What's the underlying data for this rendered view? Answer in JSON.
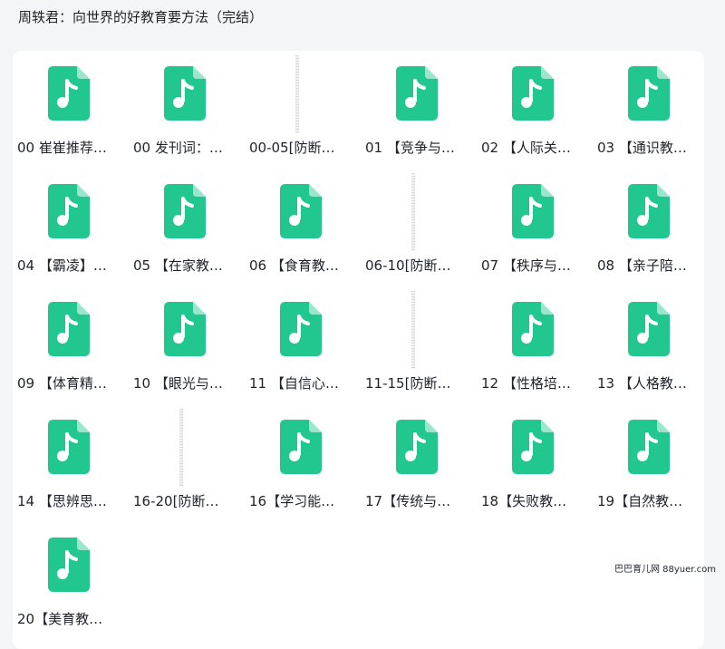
{
  "page": {
    "title": "周轶君：向世界的好教育要方法（完结）"
  },
  "colors": {
    "file_icon": "#21c78e",
    "panel_bg": "#ffffff",
    "page_bg": "#f4f5f7"
  },
  "files": [
    {
      "name": "00 崔崔推荐…",
      "type": "audio",
      "icon": "music-file-icon"
    },
    {
      "name": "00 发刊词：…",
      "type": "audio",
      "icon": "music-file-icon"
    },
    {
      "name": "00-05[防断…",
      "type": "folder-thumb",
      "icon": "thumbnail"
    },
    {
      "name": "01 【竞争与…",
      "type": "audio",
      "icon": "music-file-icon"
    },
    {
      "name": "02 【人际关…",
      "type": "audio",
      "icon": "music-file-icon"
    },
    {
      "name": "03 【通识教…",
      "type": "audio",
      "icon": "music-file-icon"
    },
    {
      "name": "04 【霸凌】…",
      "type": "audio",
      "icon": "music-file-icon"
    },
    {
      "name": "05 【在家教…",
      "type": "audio",
      "icon": "music-file-icon"
    },
    {
      "name": "06 【食育教…",
      "type": "audio",
      "icon": "music-file-icon"
    },
    {
      "name": "06-10[防断…",
      "type": "folder-thumb",
      "icon": "thumbnail"
    },
    {
      "name": "07 【秩序与…",
      "type": "audio",
      "icon": "music-file-icon"
    },
    {
      "name": "08 【亲子陪…",
      "type": "audio",
      "icon": "music-file-icon"
    },
    {
      "name": "09 【体育精…",
      "type": "audio",
      "icon": "music-file-icon"
    },
    {
      "name": "10 【眼光与…",
      "type": "audio",
      "icon": "music-file-icon"
    },
    {
      "name": "11 【自信心…",
      "type": "audio",
      "icon": "music-file-icon"
    },
    {
      "name": "11-15[防断…",
      "type": "folder-thumb",
      "icon": "thumbnail"
    },
    {
      "name": "12 【性格培…",
      "type": "audio",
      "icon": "music-file-icon"
    },
    {
      "name": "13 【人格教…",
      "type": "audio",
      "icon": "music-file-icon"
    },
    {
      "name": "14 【思辨思…",
      "type": "audio",
      "icon": "music-file-icon"
    },
    {
      "name": "16-20[防断…",
      "type": "folder-thumb",
      "icon": "thumbnail"
    },
    {
      "name": "16【学习能…",
      "type": "audio",
      "icon": "music-file-icon"
    },
    {
      "name": "17【传统与…",
      "type": "audio",
      "icon": "music-file-icon"
    },
    {
      "name": "18【失败教…",
      "type": "audio",
      "icon": "music-file-icon"
    },
    {
      "name": "19【自然教…",
      "type": "audio",
      "icon": "music-file-icon"
    },
    {
      "name": "20【美育教…",
      "type": "audio",
      "icon": "music-file-icon"
    }
  ],
  "watermark": {
    "text": "巴巴育儿网 88yuer.com"
  }
}
